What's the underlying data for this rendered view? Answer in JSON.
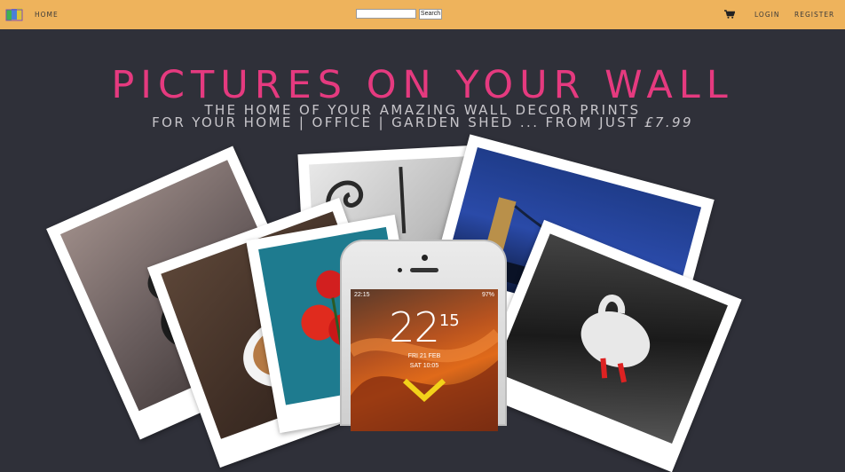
{
  "nav": {
    "home_label": "HOME",
    "search_placeholder": "",
    "search_button": "Search",
    "login_label": "LOGIN",
    "register_label": "REGISTER",
    "cart_icon": "shopping-cart-icon",
    "bar_color": "#eeb35c"
  },
  "hero": {
    "title": "PICTURES ON YOUR WALL",
    "subtitle_line1": "THE HOME OF YOUR AMAZING WALL DECOR PRINTS",
    "subtitle_line2_prefix": "FOR YOUR HOME | OFFICE | GARDEN SHED ... FROM JUST",
    "subtitle_price": "£7.99",
    "title_color": "#e53a7f",
    "background_color": "#2f3039"
  },
  "phone": {
    "status_time": "22:15",
    "battery": "97%",
    "clock_hour": "22",
    "clock_minute": "15",
    "date": "FRI 21 FEB",
    "alarm": "SAT 10:05"
  }
}
